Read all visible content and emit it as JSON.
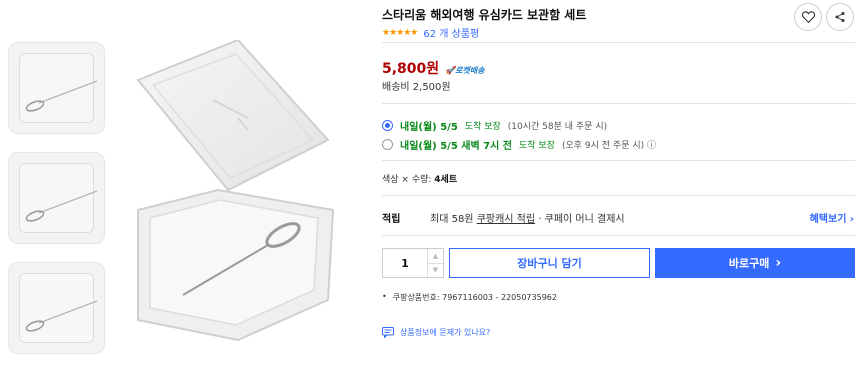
{
  "product": {
    "title": "스타리움 해외여행 유심카드 보관함 세트",
    "stars": "★★★★★",
    "review_count": "62 개 상품평"
  },
  "price": {
    "value": "5,800원",
    "rocket_badge": "로켓배송",
    "shipping": "배송비 2,500원"
  },
  "delivery_options": [
    {
      "main": "내일(월) 5/5",
      "tag": "도착 보장",
      "note": "(10시간 58분 내 주문 시)",
      "selected": true
    },
    {
      "main": "내일(월) 5/5 새벽 7시 전",
      "tag": "도착 보장",
      "note": "(오후 9시 전 주문 시) ⓘ",
      "selected": false
    }
  ],
  "spec": {
    "prefix": "색상 × 수량:",
    "value": "4세트"
  },
  "reward": {
    "label": "적립",
    "text_pre": "최대 58원",
    "text_link": "쿠팡캐시 적립",
    "text_post": "· 쿠페이 머니 결제시",
    "benefit_link": "혜택보기 ›"
  },
  "purchase": {
    "quantity": "1",
    "up_arrow": "▲",
    "down_arrow": "▼",
    "cart_label": "장바구니 담기",
    "buy_label": "바로구매",
    "buy_chevron": "›"
  },
  "product_code": {
    "bullet": "•",
    "text": "쿠팡상품번호: 7967116003 - 22050735962"
  },
  "report": {
    "text": "상품정보에 문제가 있나요?"
  },
  "colors": {
    "accent": "#346aff",
    "price": "#ae0000",
    "delivery": "#0a8a1a",
    "star": "#ff9600"
  }
}
